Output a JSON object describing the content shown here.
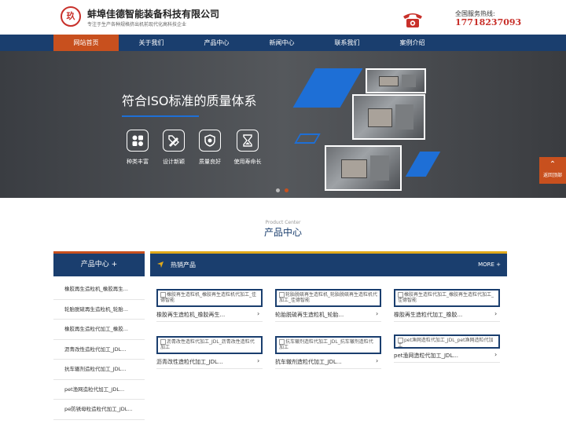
{
  "header": {
    "logo_text": "玖",
    "company_name": "蚌埠佳德智能装备科技有限公司",
    "tagline": "专注于生产各种规格挤出机前现代化高科技企业",
    "hotline_label": "全国服务热线:",
    "hotline_number": "17718237093"
  },
  "nav": {
    "items": [
      "网站首页",
      "关于我们",
      "产品中心",
      "新闻中心",
      "联系我们",
      "案例介绍"
    ],
    "active_index": 0
  },
  "banner": {
    "headline": "符合ISO标准的质量体系",
    "features": [
      {
        "label": "种类丰富",
        "icon": "grid-icon"
      },
      {
        "label": "设计新颖",
        "icon": "pencil-ruler-icon"
      },
      {
        "label": "质量良好",
        "icon": "shield-icon"
      },
      {
        "label": "使用寿命长",
        "icon": "hourglass-icon"
      }
    ],
    "slide_count": 2,
    "active_slide": 1
  },
  "back_to_top": {
    "arrow": "⌃",
    "label": "返回顶部"
  },
  "section": {
    "en": "Product Center",
    "cn": "产品中心"
  },
  "sidebar": {
    "title": "产品中心 +",
    "items": [
      "橡胶再生造粒机_橡胶再生...",
      "轮胎脱硫再生造粒机_轮胎...",
      "橡胶再生造粒代加工_橡胶...",
      "沥青改性造粒代加工_JDL...",
      "抗车辙剂造粒代加工_JDL...",
      "pet渔网造粒代加工_JDL...",
      "pe防锈母粒造粒代加工_JDL..."
    ]
  },
  "hot": {
    "title": "热销产品",
    "more": "MORE +",
    "products": [
      {
        "alt": "橡胶再生造粒机_橡胶再生造粒机代加工_佳德智能",
        "name": "橡胶再生造粒机_橡胶再生..."
      },
      {
        "alt": "轮胎脱硫再生造粒机_轮胎脱硫再生造粒机代加工_佳德智能",
        "name": "轮胎脱硫再生造粒机_轮胎..."
      },
      {
        "alt": "橡胶再生造粒代加工_橡胶再生造粒代加工_佳德智能",
        "name": "橡胶再生造粒代加工_橡胶..."
      },
      {
        "alt": "沥青改性造粒代加工_JDL_沥青改性造粒代加工",
        "name": "沥青改性造粒代加工_JDL..."
      },
      {
        "alt": "抗车辙剂造粒代加工_JDL_抗车辙剂造粒代加工",
        "name": "抗车辙剂造粒代加工_JDL..."
      },
      {
        "alt": "pet渔网造粒代加工_JDL_pet渔网造粒代加工",
        "name": "pet渔网造粒代加工_JDL..."
      }
    ]
  },
  "colors": {
    "navy": "#1a3e6e",
    "accent": "#c8501e",
    "gold": "#e0a91b",
    "blue": "#1e6fd6",
    "red": "#c8302a"
  }
}
